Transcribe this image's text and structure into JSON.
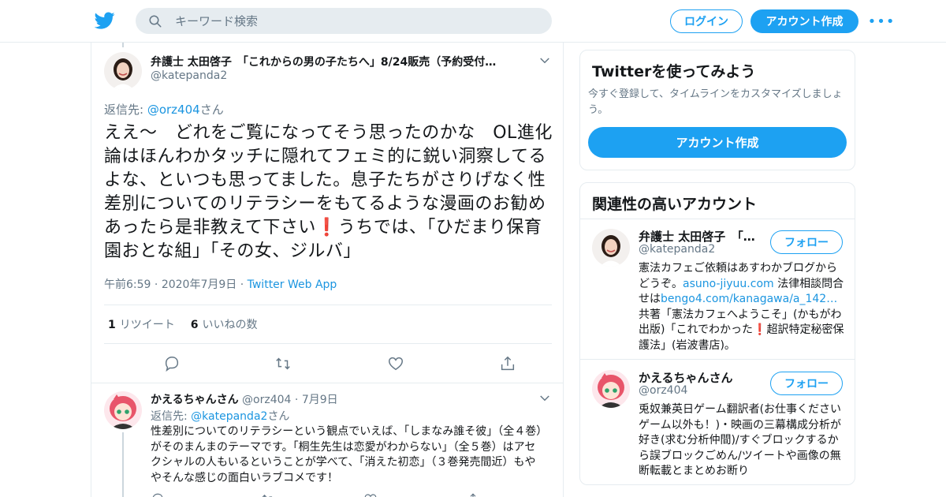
{
  "header": {
    "search_placeholder": "キーワード検索",
    "login_label": "ログイン",
    "signup_label": "アカウント作成",
    "more_label": "•••"
  },
  "tweet": {
    "author_name": "弁護士 太田啓子　「これからの男の子たちへ」8/24販売（予約受付…",
    "author_handle": "@katepanda2",
    "reply_prefix": "返信先: ",
    "reply_handle": "@orz404",
    "reply_suffix": "さん",
    "text_part1": "ええ～　どれをご覧になってそう思ったのかな　OL進化論はほんわかタッチに隠れてフェミ的に鋭い洞察してるよな、といつも思ってました。息子たちがさりげなく性差別についてのリテラシーをもてるような漫画のお勧めあったら是非教えて下さい",
    "text_emoji": "❗",
    "text_part2": "うちでは、「ひだまり保育園おとな組」「その女、ジルバ」",
    "time": "午前6:59",
    "date": "2020年7月9日",
    "source": "Twitter Web App",
    "retweet_count": "1",
    "retweet_label": "リツイート",
    "like_count": "6",
    "like_label": "いいねの数"
  },
  "reply": {
    "author_name": "かえるちゃんさん",
    "author_handle": "@orz404",
    "date": "7月9日",
    "reply_prefix": "返信先: ",
    "reply_handle": "@katepanda2",
    "reply_suffix": "さん",
    "text": "性差別についてのリテラシーという観点でいえば、「しまなみ誰そ彼」（全４巻）がそのまんまのテーマです。「桐生先生は恋愛がわからない」（全５巻）はアセクシャルの人もいるということが学べて、「消えた初恋」（３巻発売間近）もややそんな感じの面白いラブコメです！"
  },
  "sidebar": {
    "try_title": "Twitterを使ってみよう",
    "try_sub": "今すぐ登録して、タイムラインをカスタマイズしましょう。",
    "try_button": "アカウント作成",
    "related_title": "関連性の高いアカウント",
    "accounts": [
      {
        "name": "弁護士 太田啓子　「…",
        "handle": "@katepanda2",
        "follow": "フォロー",
        "bio_a": "憲法カフェご依頼はあすわかブログからどうぞ。",
        "bio_link1": "asuno-jiyuu.com",
        "bio_b": " 法律相談問合せは",
        "bio_link2": "bengo4.com/kanagawa/a_142…",
        "bio_c": " 共著「憲法カフェへようこそ」(かもがわ出版)「これでわかった",
        "bio_emoji": "❗",
        "bio_d": "超訳特定秘密保護法」(岩波書店)。"
      },
      {
        "name": "かえるちゃんさん",
        "handle": "@orz404",
        "follow": "フォロー",
        "bio": "兎奴兼英日ゲーム翻訳者(お仕事ください ゲーム以外も！)・映画の三幕構成分析が好き(求む分析仲間)/すぐブロックするから誤ブロックごめん/ツイートや画像の無断転載とまとめお断り"
      }
    ]
  },
  "colors": {
    "accent": "#1da1f2",
    "link": "#1b95e0",
    "muted": "#657786",
    "border": "#e6ecf0"
  },
  "icons": {
    "logo": "twitter-bird-icon",
    "search": "search-icon",
    "caret": "chevron-down-icon",
    "reply": "reply-icon",
    "retweet": "retweet-icon",
    "like": "heart-icon",
    "share": "share-icon"
  }
}
